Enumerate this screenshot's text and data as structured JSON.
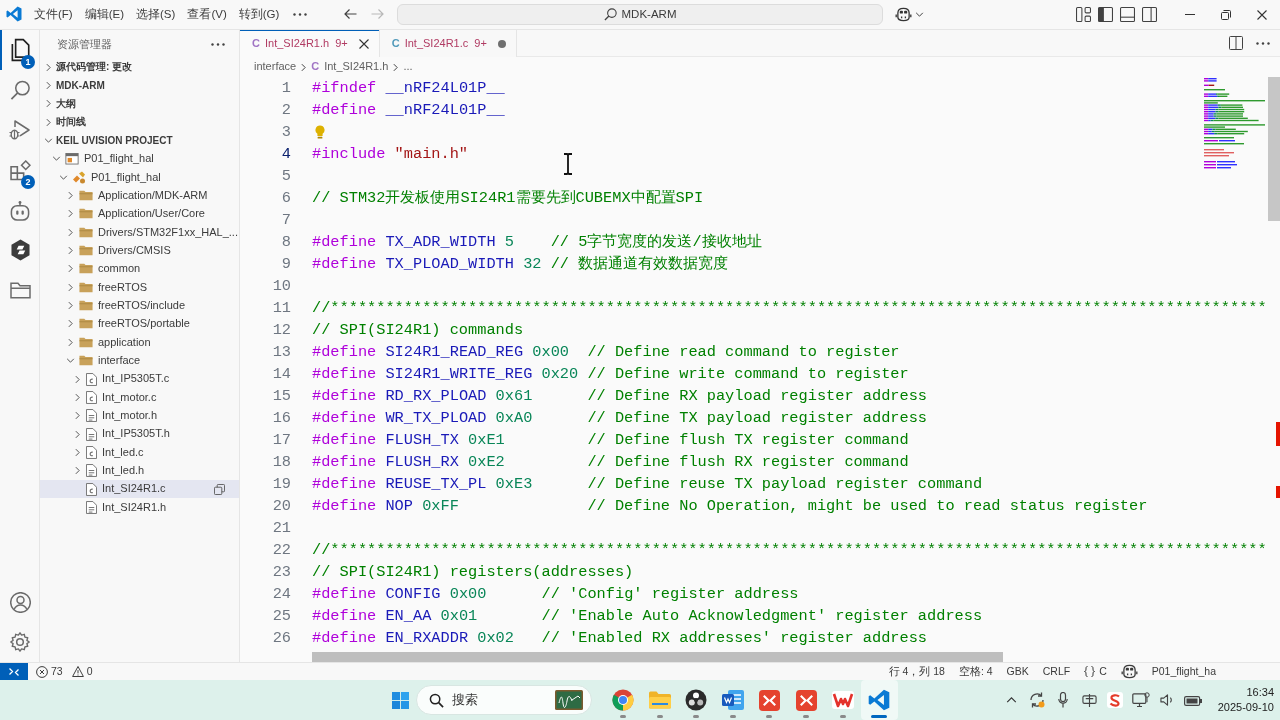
{
  "title_bar": {
    "menus": [
      "文件(F)",
      "编辑(E)",
      "选择(S)",
      "查看(V)",
      "转到(G)"
    ],
    "nav": [
      {
        "kind": "back",
        "disabled": false
      },
      {
        "kind": "forward",
        "disabled": true
      }
    ],
    "command_center": "MDK-ARM"
  },
  "activity_bar": {
    "items": [
      {
        "kind": "explorer",
        "selected": true,
        "badge": "1"
      },
      {
        "kind": "search",
        "selected": false
      },
      {
        "kind": "run-debug",
        "selected": false
      },
      {
        "kind": "extensions",
        "selected": false,
        "badge": "2"
      },
      {
        "kind": "robot",
        "selected": false
      },
      {
        "kind": "hexagon",
        "selected": false
      },
      {
        "kind": "folder",
        "selected": false
      }
    ],
    "bottom": [
      {
        "kind": "account"
      },
      {
        "kind": "settings"
      }
    ]
  },
  "sidebar": {
    "title": "资源管理器",
    "sections": [
      {
        "label": "源代码管理: 更改",
        "expanded": false
      },
      {
        "label": "MDK-ARM",
        "expanded": false
      },
      {
        "label": "大纲",
        "expanded": false
      },
      {
        "label": "时间线",
        "expanded": false
      },
      {
        "label": "KEIL UVISION PROJECT",
        "expanded": true,
        "tree": [
          {
            "label": "P01_flight_hal",
            "kind": "project",
            "expanded": true,
            "selected": false,
            "children": [
              {
                "label": "P01_flight_hal",
                "kind": "target",
                "expanded": true,
                "selected": false,
                "children": [
                  {
                    "label": "Application/MDK-ARM",
                    "kind": "folder",
                    "expanded": false,
                    "selected": false
                  },
                  {
                    "label": "Application/User/Core",
                    "kind": "folder",
                    "expanded": false,
                    "selected": false
                  },
                  {
                    "label": "Drivers/STM32F1xx_HAL_...",
                    "kind": "folder",
                    "expanded": false,
                    "selected": false
                  },
                  {
                    "label": "Drivers/CMSIS",
                    "kind": "folder",
                    "expanded": false,
                    "selected": false
                  },
                  {
                    "label": "common",
                    "kind": "folder",
                    "expanded": false,
                    "selected": false
                  },
                  {
                    "label": "freeRTOS",
                    "kind": "folder",
                    "expanded": false,
                    "selected": false
                  },
                  {
                    "label": "freeRTOS/include",
                    "kind": "folder",
                    "expanded": false,
                    "selected": false
                  },
                  {
                    "label": "freeRTOS/portable",
                    "kind": "folder",
                    "expanded": false,
                    "selected": false
                  },
                  {
                    "label": "application",
                    "kind": "folder",
                    "expanded": false,
                    "selected": false
                  },
                  {
                    "label": "interface",
                    "kind": "folder",
                    "expanded": true,
                    "selected": false,
                    "children": [
                      {
                        "label": "Int_IP5305T.c",
                        "kind": "c-file",
                        "expanded": false,
                        "selected": false
                      },
                      {
                        "label": "Int_motor.c",
                        "kind": "c-file",
                        "expanded": false,
                        "selected": false
                      },
                      {
                        "label": "Int_motor.h",
                        "kind": "h-file",
                        "expanded": false,
                        "selected": false
                      },
                      {
                        "label": "Int_IP5305T.h",
                        "kind": "h-file",
                        "expanded": false,
                        "selected": false
                      },
                      {
                        "label": "Int_led.c",
                        "kind": "c-file",
                        "expanded": false,
                        "selected": false
                      },
                      {
                        "label": "Int_led.h",
                        "kind": "h-file",
                        "expanded": false,
                        "selected": false
                      },
                      {
                        "label": "Int_SI24R1.c",
                        "kind": "c-file",
                        "selected": true
                      },
                      {
                        "label": "Int_SI24R1.h",
                        "kind": "h-file",
                        "selected": false
                      }
                    ]
                  }
                ]
              }
            ]
          }
        ]
      }
    ]
  },
  "editor": {
    "tabs": [
      {
        "icon": "C",
        "kind": "h-file",
        "label": "Int_SI24R1.h",
        "problems": "9+",
        "selected": true,
        "modified": false
      },
      {
        "icon": "C",
        "kind": "c-file",
        "label": "Int_SI24R1.c",
        "problems": "9+",
        "selected": false,
        "modified": true
      }
    ],
    "breadcrumb": {
      "folder": "interface",
      "file_icon": "C",
      "file": "Int_SI24R1.h",
      "more": "..."
    },
    "lines": [
      {
        "number": "1",
        "current": false,
        "tokens": [
          {
            "kind": "directive",
            "text": "#ifndef"
          },
          {
            "kind": "macro",
            "text": " __nRF24L01P__"
          }
        ]
      },
      {
        "number": "2",
        "current": false,
        "tokens": [
          {
            "kind": "directive",
            "text": "#define"
          },
          {
            "kind": "macro",
            "text": " __nRF24L01P__"
          }
        ]
      },
      {
        "number": "3",
        "current": false,
        "lightbulb": true
      },
      {
        "number": "4",
        "current": true,
        "tokens": [
          {
            "kind": "directive",
            "text": "#include"
          },
          {
            "kind": "string",
            "text": " \"main.h\""
          }
        ]
      },
      {
        "number": "5",
        "current": false
      },
      {
        "number": "6",
        "current": false,
        "tokens": [
          {
            "kind": "comment",
            "text": "// STM32开发板使用SI24R1需要先到CUBEMX中配置SPI"
          }
        ]
      },
      {
        "number": "7",
        "current": false
      },
      {
        "number": "8",
        "current": false,
        "tokens": [
          {
            "kind": "directive",
            "text": "#define"
          },
          {
            "kind": "macro",
            "text": " TX_ADR_WIDTH"
          },
          {
            "kind": "number",
            "text": " 5"
          },
          {
            "kind": "comment",
            "text": "    // 5字节宽度的发送/接收地址"
          }
        ]
      },
      {
        "number": "9",
        "current": false,
        "tokens": [
          {
            "kind": "directive",
            "text": "#define"
          },
          {
            "kind": "macro",
            "text": " TX_PLOAD_WIDTH"
          },
          {
            "kind": "number",
            "text": " 32"
          },
          {
            "kind": "comment",
            "text": " // 数据通道有效数据宽度"
          }
        ]
      },
      {
        "number": "10",
        "current": false
      },
      {
        "number": "11",
        "current": false,
        "tokens": [
          {
            "kind": "comment",
            "text": "//******************************************************************************************************"
          }
        ]
      },
      {
        "number": "12",
        "current": false,
        "tokens": [
          {
            "kind": "comment",
            "text": "// SPI(SI24R1) commands"
          }
        ]
      },
      {
        "number": "13",
        "current": false,
        "tokens": [
          {
            "kind": "directive",
            "text": "#define"
          },
          {
            "kind": "macro",
            "text": " SI24R1_READ_REG"
          },
          {
            "kind": "number",
            "text": " 0x00"
          },
          {
            "kind": "comment",
            "text": "  // Define read command to register"
          }
        ]
      },
      {
        "number": "14",
        "current": false,
        "tokens": [
          {
            "kind": "directive",
            "text": "#define"
          },
          {
            "kind": "macro",
            "text": " SI24R1_WRITE_REG"
          },
          {
            "kind": "number",
            "text": " 0x20"
          },
          {
            "kind": "comment",
            "text": " // Define write command to register"
          }
        ]
      },
      {
        "number": "15",
        "current": false,
        "tokens": [
          {
            "kind": "directive",
            "text": "#define"
          },
          {
            "kind": "macro",
            "text": " RD_RX_PLOAD"
          },
          {
            "kind": "number",
            "text": " 0x61"
          },
          {
            "kind": "comment",
            "text": "      // Define RX payload register address"
          }
        ]
      },
      {
        "number": "16",
        "current": false,
        "tokens": [
          {
            "kind": "directive",
            "text": "#define"
          },
          {
            "kind": "macro",
            "text": " WR_TX_PLOAD"
          },
          {
            "kind": "number",
            "text": " 0xA0"
          },
          {
            "kind": "comment",
            "text": "      // Define TX payload register address"
          }
        ]
      },
      {
        "number": "17",
        "current": false,
        "tokens": [
          {
            "kind": "directive",
            "text": "#define"
          },
          {
            "kind": "macro",
            "text": " FLUSH_TX"
          },
          {
            "kind": "number",
            "text": " 0xE1"
          },
          {
            "kind": "comment",
            "text": "         // Define flush TX register command"
          }
        ]
      },
      {
        "number": "18",
        "current": false,
        "tokens": [
          {
            "kind": "directive",
            "text": "#define"
          },
          {
            "kind": "macro",
            "text": " FLUSH_RX"
          },
          {
            "kind": "number",
            "text": " 0xE2"
          },
          {
            "kind": "comment",
            "text": "         // Define flush RX register command"
          }
        ]
      },
      {
        "number": "19",
        "current": false,
        "tokens": [
          {
            "kind": "directive",
            "text": "#define"
          },
          {
            "kind": "macro",
            "text": " REUSE_TX_PL"
          },
          {
            "kind": "number",
            "text": " 0xE3"
          },
          {
            "kind": "comment",
            "text": "      // Define reuse TX payload register command"
          }
        ]
      },
      {
        "number": "20",
        "current": false,
        "tokens": [
          {
            "kind": "directive",
            "text": "#define"
          },
          {
            "kind": "macro",
            "text": " NOP"
          },
          {
            "kind": "number",
            "text": " 0xFF"
          },
          {
            "kind": "comment",
            "text": "              // Define No Operation, might be used to read status register"
          }
        ]
      },
      {
        "number": "21",
        "current": false
      },
      {
        "number": "22",
        "current": false,
        "tokens": [
          {
            "kind": "comment",
            "text": "//******************************************************************************************************"
          }
        ]
      },
      {
        "number": "23",
        "current": false,
        "tokens": [
          {
            "kind": "comment",
            "text": "// SPI(SI24R1) registers(addresses)"
          }
        ]
      },
      {
        "number": "24",
        "current": false,
        "tokens": [
          {
            "kind": "directive",
            "text": "#define"
          },
          {
            "kind": "macro",
            "text": " CONFIG"
          },
          {
            "kind": "number",
            "text": " 0x00"
          },
          {
            "kind": "comment",
            "text": "      // 'Config' register address"
          }
        ]
      },
      {
        "number": "25",
        "current": false,
        "tokens": [
          {
            "kind": "directive",
            "text": "#define"
          },
          {
            "kind": "macro",
            "text": " EN_AA"
          },
          {
            "kind": "number",
            "text": " 0x01"
          },
          {
            "kind": "comment",
            "text": "       // 'Enable Auto Acknowledgment' register address"
          }
        ]
      },
      {
        "number": "26",
        "current": false,
        "tokens": [
          {
            "kind": "directive",
            "text": "#define"
          },
          {
            "kind": "macro",
            "text": " EN_RXADDR"
          },
          {
            "kind": "number",
            "text": " 0x02"
          },
          {
            "kind": "comment",
            "text": "   // 'Enabled RX addresses' register address"
          }
        ]
      }
    ]
  },
  "status_bar": {
    "errors": "73",
    "warnings": "0",
    "items": [
      {
        "kind": "text",
        "text": "行 4，列 18"
      },
      {
        "kind": "text",
        "text": "空格: 4"
      },
      {
        "kind": "text",
        "text": "GBK"
      },
      {
        "kind": "text",
        "text": "CRLF"
      },
      {
        "kind": "language",
        "text": "C"
      },
      {
        "kind": "copilot"
      },
      {
        "kind": "text",
        "text": "P01_flight_ha"
      }
    ]
  },
  "taskbar": {
    "search_placeholder": "搜索",
    "apps": [
      {
        "kind": "browser",
        "running": true,
        "active": false
      },
      {
        "kind": "files",
        "running": true,
        "active": false
      },
      {
        "kind": "recorder",
        "running": true,
        "active": false
      },
      {
        "kind": "document",
        "running": true,
        "active": false
      },
      {
        "kind": "red-app",
        "running": true,
        "active": false
      },
      {
        "kind": "red-app",
        "running": true,
        "active": false
      },
      {
        "kind": "office",
        "running": true,
        "active": false
      },
      {
        "kind": "code-editor",
        "running": true,
        "active": true
      }
    ],
    "tray": [
      {
        "kind": "chevron"
      },
      {
        "kind": "sync"
      },
      {
        "kind": "microphone"
      },
      {
        "kind": "input-method"
      },
      {
        "kind": "input-app"
      },
      {
        "kind": "network"
      },
      {
        "kind": "volume"
      },
      {
        "kind": "battery"
      }
    ],
    "time": "16:34",
    "date": "2025-09-10"
  }
}
